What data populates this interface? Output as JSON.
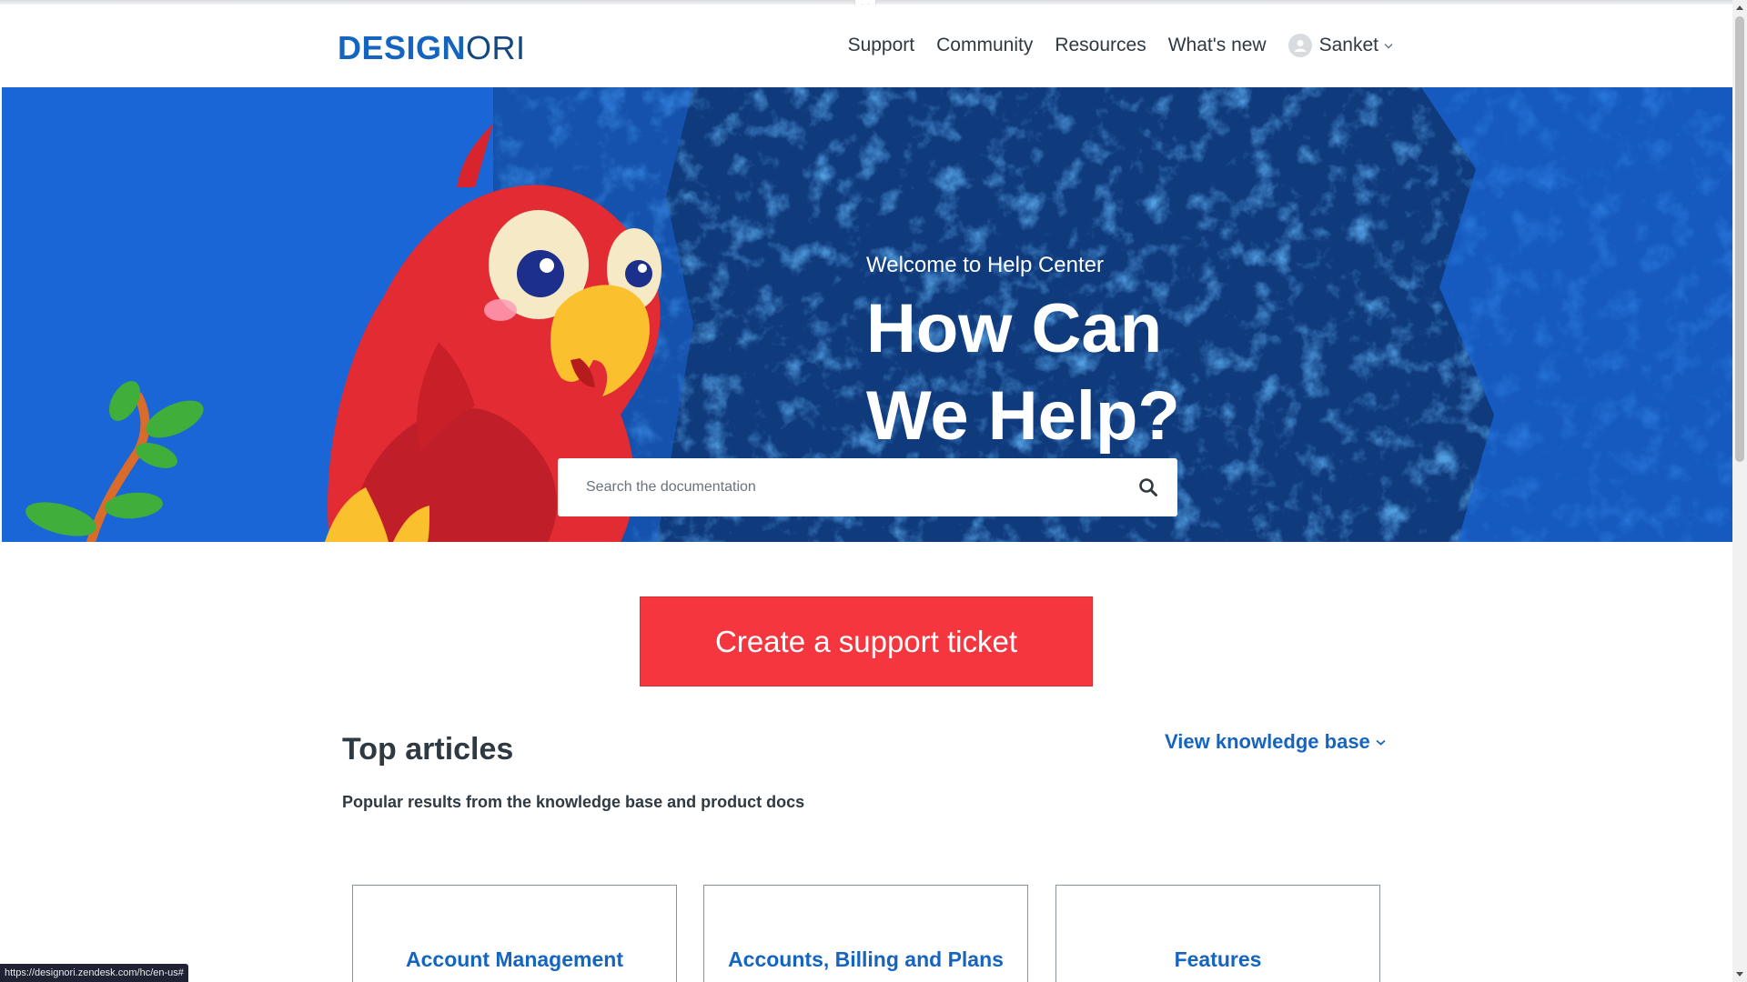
{
  "header": {
    "logo_part1": "DESIGN",
    "logo_part2": "ORI",
    "nav": [
      "Support",
      "Community",
      "Resources",
      "What's new"
    ],
    "user_name": "Sanket"
  },
  "hero": {
    "welcome": "Welcome to Help Center",
    "title_line1": "How Can",
    "title_line2": "We Help?",
    "search_placeholder": "Search the documentation"
  },
  "cta": {
    "label": "Create a support ticket"
  },
  "articles": {
    "title": "Top articles",
    "subtitle": "Popular results from the knowledge base and product docs",
    "view_kb_label": "View knowledge base",
    "cards": [
      "Account Management",
      "Accounts, Billing and Plans",
      "Features"
    ]
  },
  "status_bar": {
    "url": "https://designori.zendesk.com/hc/en-us#"
  },
  "colors": {
    "brand_blue": "#1565c0",
    "hero_navy": "#0f3a7c",
    "hero_bright": "#1a66d6",
    "cta_red": "#f6363e"
  },
  "icons": [
    "chevron-down-icon",
    "user-avatar-icon",
    "search-icon",
    "parrot-illustration",
    "branch-illustration"
  ]
}
